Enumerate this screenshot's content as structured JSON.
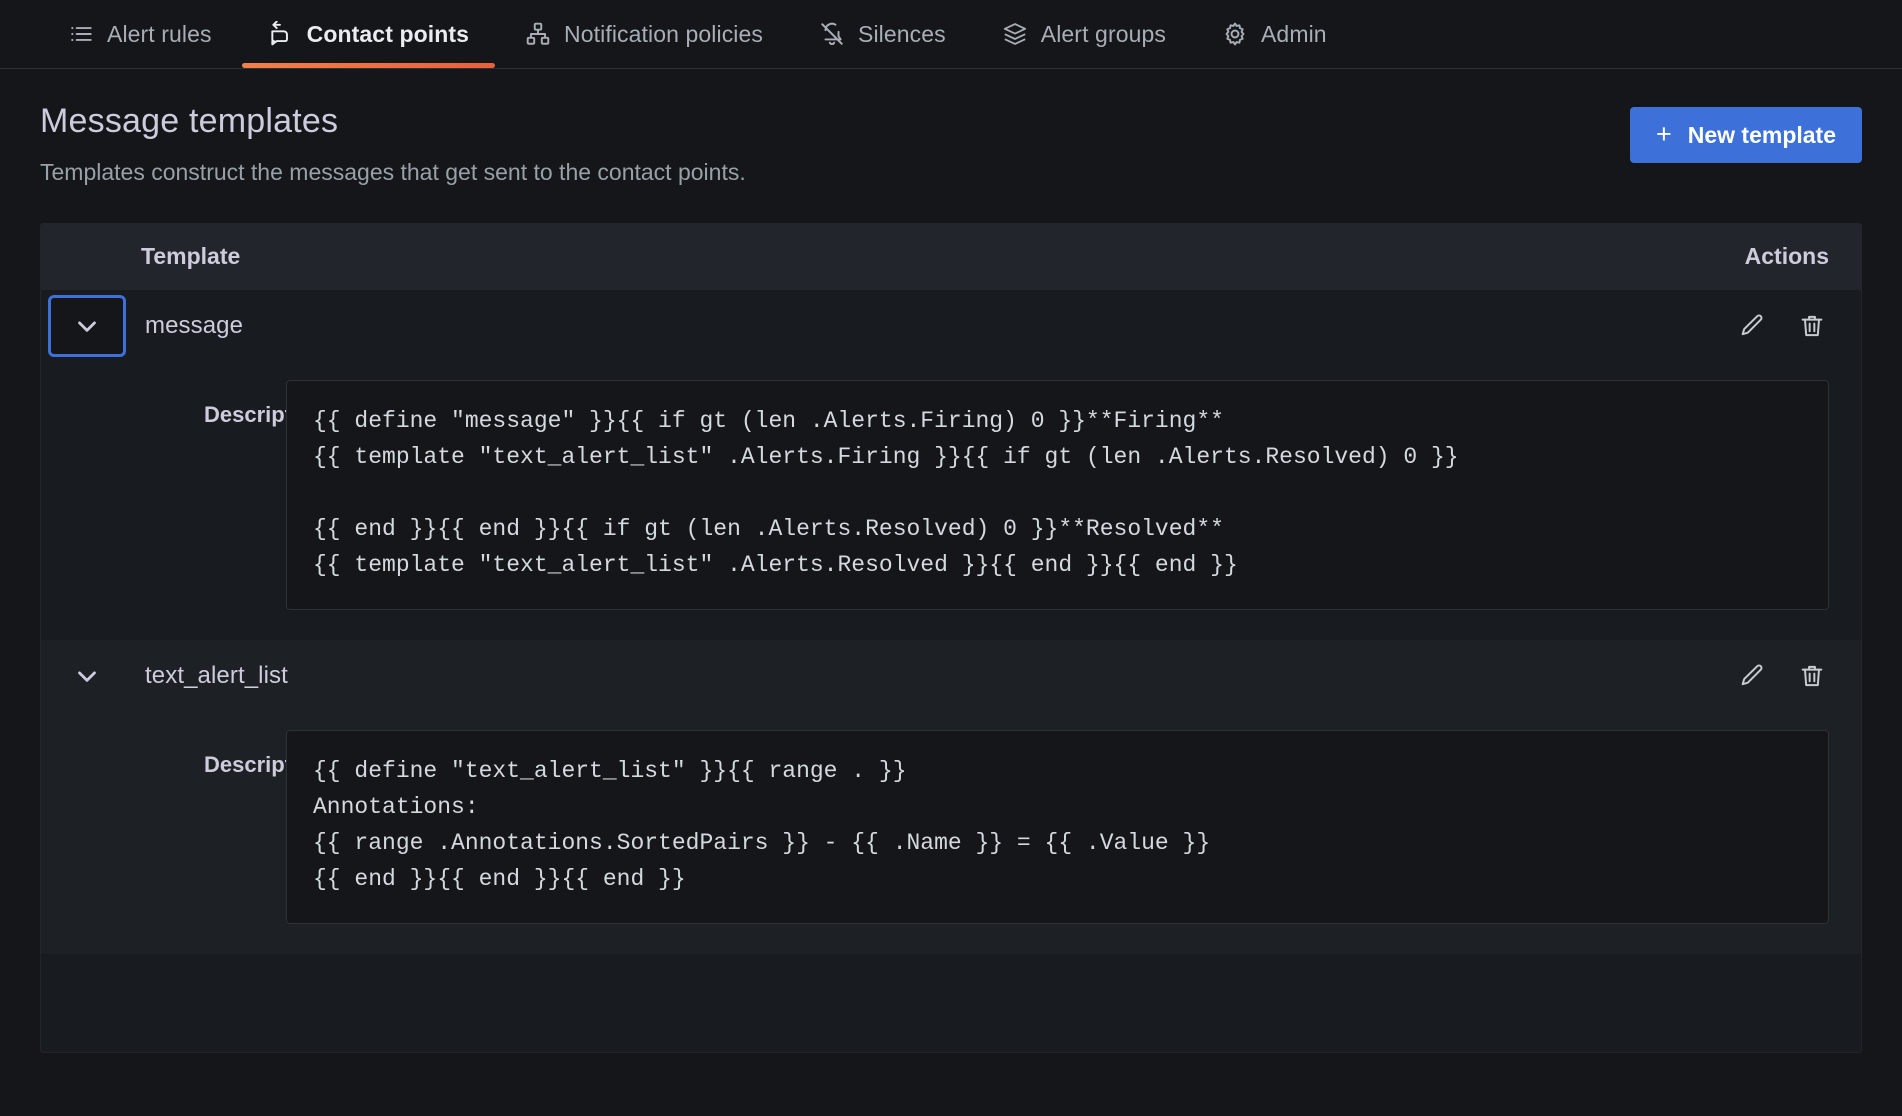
{
  "nav": {
    "tabs": [
      {
        "id": "alert-rules",
        "label": "Alert rules",
        "icon": "list-ul-icon",
        "active": false
      },
      {
        "id": "contact-points",
        "label": "Contact points",
        "icon": "comment-alt-share-icon",
        "active": true
      },
      {
        "id": "notification-policies",
        "label": "Notification policies",
        "icon": "sitemap-icon",
        "active": false
      },
      {
        "id": "silences",
        "label": "Silences",
        "icon": "bell-slash-icon",
        "active": false
      },
      {
        "id": "alert-groups",
        "label": "Alert groups",
        "icon": "layer-group-icon",
        "active": false
      },
      {
        "id": "admin",
        "label": "Admin",
        "icon": "gear-icon",
        "active": false
      }
    ]
  },
  "header": {
    "title": "Message templates",
    "subtitle": "Templates construct the messages that get sent to the contact points.",
    "new_template_label": "New template",
    "new_template_plus": "+"
  },
  "table": {
    "columns": {
      "template": "Template",
      "actions": "Actions"
    },
    "description_label": "Description",
    "rows": [
      {
        "name": "message",
        "expanded": true,
        "chevron_focused": true,
        "description": "{{ define \"message\" }}{{ if gt (len .Alerts.Firing) 0 }}**Firing**\n{{ template \"text_alert_list\" .Alerts.Firing }}{{ if gt (len .Alerts.Resolved) 0 }}\n\n{{ end }}{{ end }}{{ if gt (len .Alerts.Resolved) 0 }}**Resolved**\n{{ template \"text_alert_list\" .Alerts.Resolved }}{{ end }}{{ end }}"
      },
      {
        "name": "text_alert_list",
        "expanded": true,
        "chevron_focused": false,
        "description": "{{ define \"text_alert_list\" }}{{ range . }}\nAnnotations:\n{{ range .Annotations.SortedPairs }} - {{ .Name }} = {{ .Value }}\n{{ end }}{{ end }}{{ end }}"
      }
    ]
  },
  "colors": {
    "accent_tab": "#f2804a",
    "primary_button": "#3d71d9",
    "focus_ring": "#3d71d9",
    "page_bg": "#141619",
    "card_bg": "#181b1f",
    "row_alt_bg": "#1d2025",
    "text_primary": "#ccccdc",
    "text_secondary": "#9aa0a8"
  }
}
